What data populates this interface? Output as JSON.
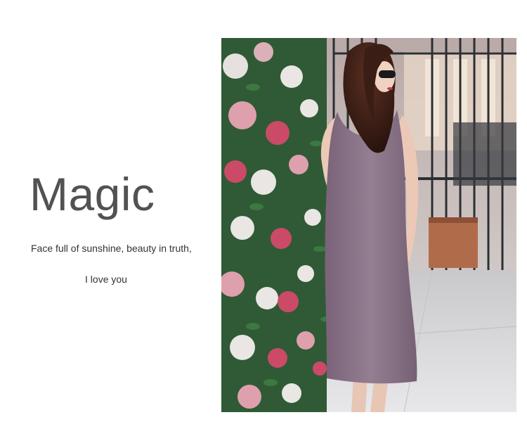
{
  "headline": "Magic",
  "tagline": {
    "line1": "Face full of sunshine, beauty in truth,",
    "line2": "I love you"
  },
  "photo": {
    "subject": "woman-in-purple-sleeveless-dress",
    "colors": {
      "dress": "#8a7388",
      "flowers_pink": "#d44a6a",
      "flowers_white": "#f3eeee",
      "leaves": "#2f5a35",
      "floor": "#d8d6d8",
      "fence": "#2c2f33"
    }
  }
}
